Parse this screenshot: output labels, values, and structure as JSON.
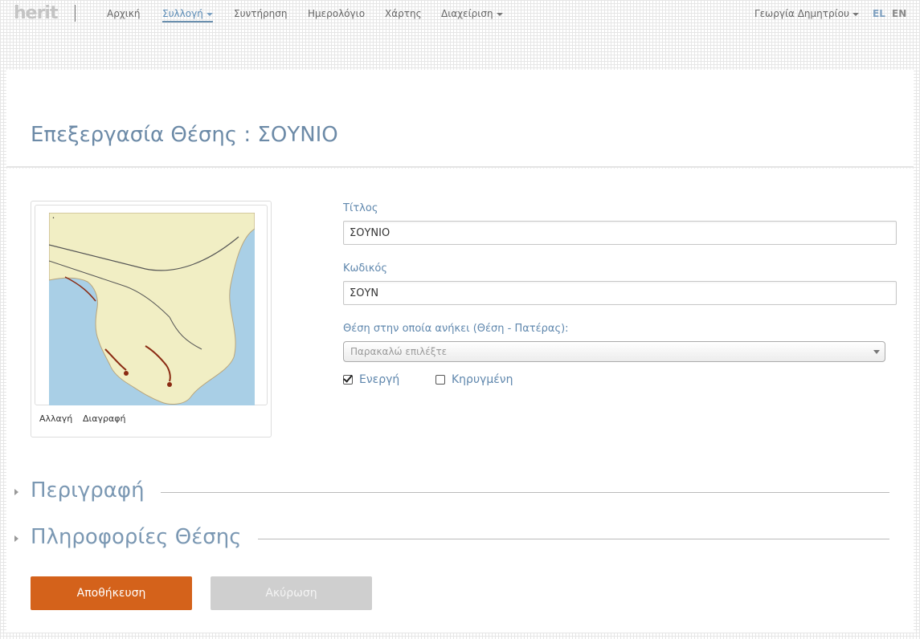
{
  "app": {
    "logo_text": "herit"
  },
  "nav": {
    "items": [
      {
        "label": "Αρχική"
      },
      {
        "label": "Συλλογή"
      },
      {
        "label": "Συντήρηση"
      },
      {
        "label": "Ημερολόγιο"
      },
      {
        "label": "Χάρτης"
      },
      {
        "label": "Διαχείριση"
      }
    ],
    "active_item": "Συλλογή",
    "user_name": "Γεωργία Δημητρίου",
    "languages": [
      {
        "label": "EL",
        "active": true
      },
      {
        "label": "EN",
        "active": false
      }
    ]
  },
  "page": {
    "title": "Επεξεργασία Θέσης : ΣΟΥΝΙΟ"
  },
  "image_card": {
    "image_icon": "map-image",
    "change_label": "Αλλαγή",
    "delete_label": "Διαγραφή"
  },
  "form": {
    "title_label": "Τίτλος",
    "title_value": "ΣΟΥΝΙΟ",
    "code_label": "Κωδικός",
    "code_value": "ΣΟΥΝ",
    "parent_label": "Θέση στην οποία ανήκει (Θέση - Πατέρας):",
    "parent_placeholder": "Παρακαλώ επιλέξτε",
    "active_label": "Ενεργή",
    "active_checked": true,
    "declared_label": "Κηρυγμένη",
    "declared_checked": false
  },
  "sections": [
    {
      "title": "Περιγραφή",
      "expanded": false
    },
    {
      "title": "Πληροφορίες Θέσης",
      "expanded": false
    }
  ],
  "actions": {
    "save_label": "Αποθήκευση",
    "cancel_label": "Ακύρωση"
  },
  "colors": {
    "accent": "#5f87ad",
    "save_button": "#d4621b",
    "cancel_button": "#cfcfcf"
  }
}
